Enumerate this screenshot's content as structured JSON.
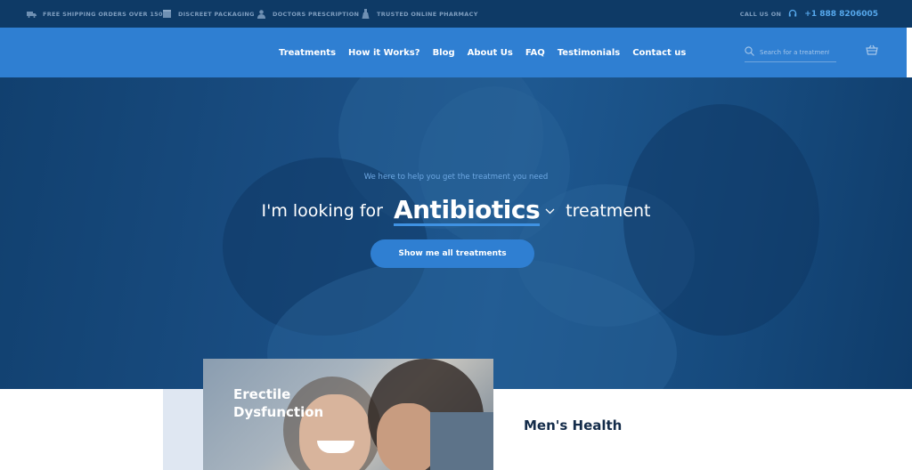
{
  "topbar": {
    "items": [
      {
        "label": "FREE SHIPPING ORDERS OVER 150$",
        "icon": "truck-icon"
      },
      {
        "label": "DISCREET PACKAGING",
        "icon": "package-icon"
      },
      {
        "label": "DOCTORS PRESCRIPTION",
        "icon": "doctor-icon"
      },
      {
        "label": "TRUSTED ONLINE PHARMACY",
        "icon": "pharmacy-icon"
      }
    ],
    "call_label": "CALL US ON",
    "phone": "+1 888 8206005"
  },
  "nav": {
    "links": [
      "Treatments",
      "How it Works?",
      "Blog",
      "About Us",
      "FAQ",
      "Testimonials",
      "Contact us"
    ],
    "search_placeholder": "Search for a treatment"
  },
  "hero": {
    "subtitle": "We here to help you get the treatment you need",
    "prefix": "I'm looking for",
    "selected": "Antibiotics",
    "suffix": "treatment",
    "button": "Show me all treatments"
  },
  "featured": {
    "card_title": "Erectile Dysfunction",
    "section_title": "Men's Health"
  },
  "colors": {
    "topbar_bg": "#0e3a66",
    "nav_bg": "#2f7fd2",
    "accent": "#56a8ec",
    "heading": "#142c4a"
  }
}
